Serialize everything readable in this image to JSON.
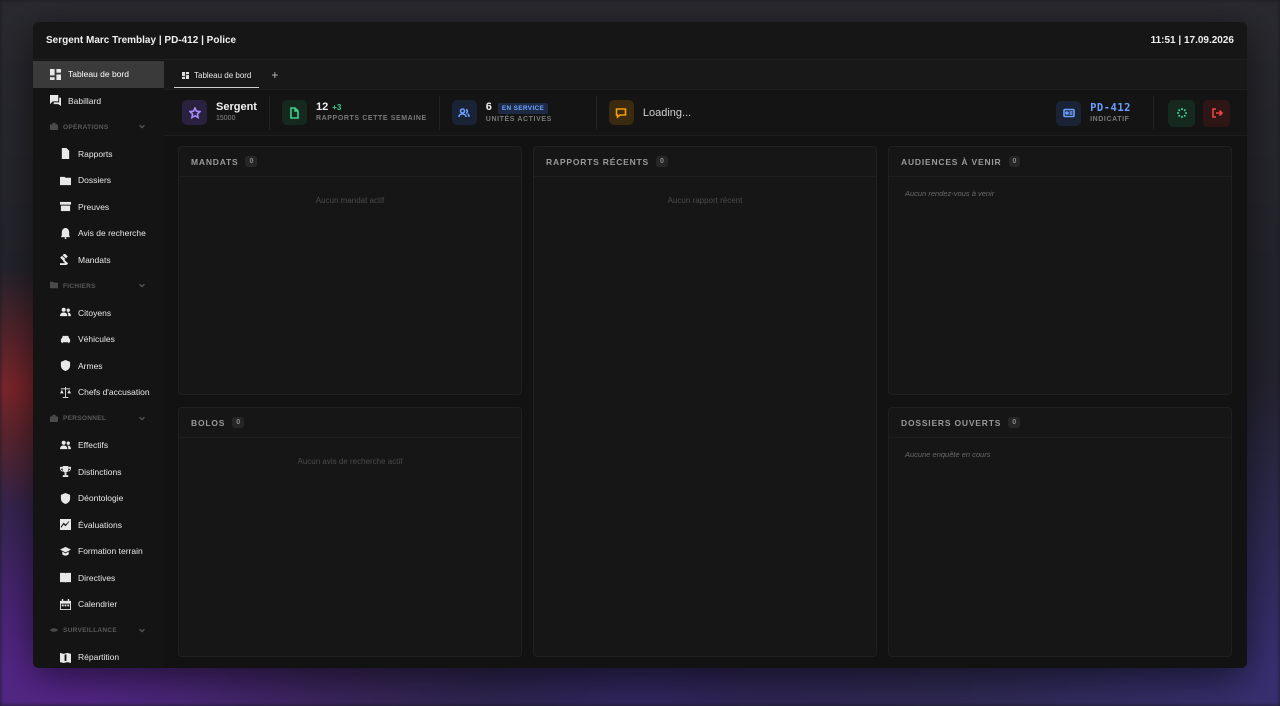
{
  "titlebar": {
    "user": "Sergent Marc Tremblay | PD-412 | Police",
    "clock": "11:51 | 17.09.2026"
  },
  "sidebar": {
    "dashboard": "Tableau de bord",
    "board": "Babillard",
    "operations": {
      "title": "OPÉRATIONS",
      "items": [
        "Rapports",
        "Dossiers",
        "Preuves",
        "Avis de recherche",
        "Mandats"
      ]
    },
    "files": {
      "title": "FICHIERS",
      "items": [
        "Citoyens",
        "Véhicules",
        "Armes",
        "Chefs d'accusation"
      ]
    },
    "personnel": {
      "title": "PERSONNEL",
      "items": [
        "Effectifs",
        "Distinctions",
        "Déontologie",
        "Évaluations",
        "Formation terrain",
        "Directives",
        "Calendrier"
      ]
    },
    "surveillance": {
      "title": "SURVEILLANCE",
      "items": [
        "Répartition"
      ]
    }
  },
  "tabs": {
    "active": "Tableau de bord",
    "add": "+"
  },
  "stats": {
    "rank": {
      "value": "Sergent",
      "sub": "15000"
    },
    "reports": {
      "value": "12",
      "delta": "+3",
      "label": "RAPPORTS CETTE SEMAINE"
    },
    "units": {
      "value": "6",
      "badge": "EN SERVICE",
      "label": "UNITÉS ACTIVES"
    },
    "messages": {
      "value": "Loading..."
    },
    "callsign": {
      "value": "PD-412",
      "label": "INDICATIF"
    }
  },
  "panels": {
    "mandats": {
      "title": "MANDATS",
      "count": "0",
      "empty": "Aucun mandat actif"
    },
    "reports": {
      "title": "RAPPORTS RÉCENTS",
      "count": "0",
      "empty": "Aucun rapport récent"
    },
    "hearings": {
      "title": "AUDIENCES À VENIR",
      "count": "0",
      "empty": "Aucun rendez-vous à venir"
    },
    "bolos": {
      "title": "BOLOS",
      "count": "0",
      "empty": "Aucun avis de recherche actif"
    },
    "cases": {
      "title": "DOSSIERS OUVERTS",
      "count": "0",
      "empty": "Aucune enquête en cours"
    }
  },
  "colors": {
    "accent_blue": "#6c9fff",
    "accent_green": "#3ecf8e",
    "accent_purple": "#a78bfa",
    "accent_orange": "#f59e0b",
    "danger": "#ef4444"
  },
  "icons": {
    "dashboard": "grid-icon",
    "board": "chat-icon",
    "rank": "star-icon",
    "reports": "document-icon",
    "units": "users-icon",
    "messages": "message-icon",
    "callsign": "id-card-icon",
    "status": "loader-icon",
    "logout": "logout-icon"
  }
}
